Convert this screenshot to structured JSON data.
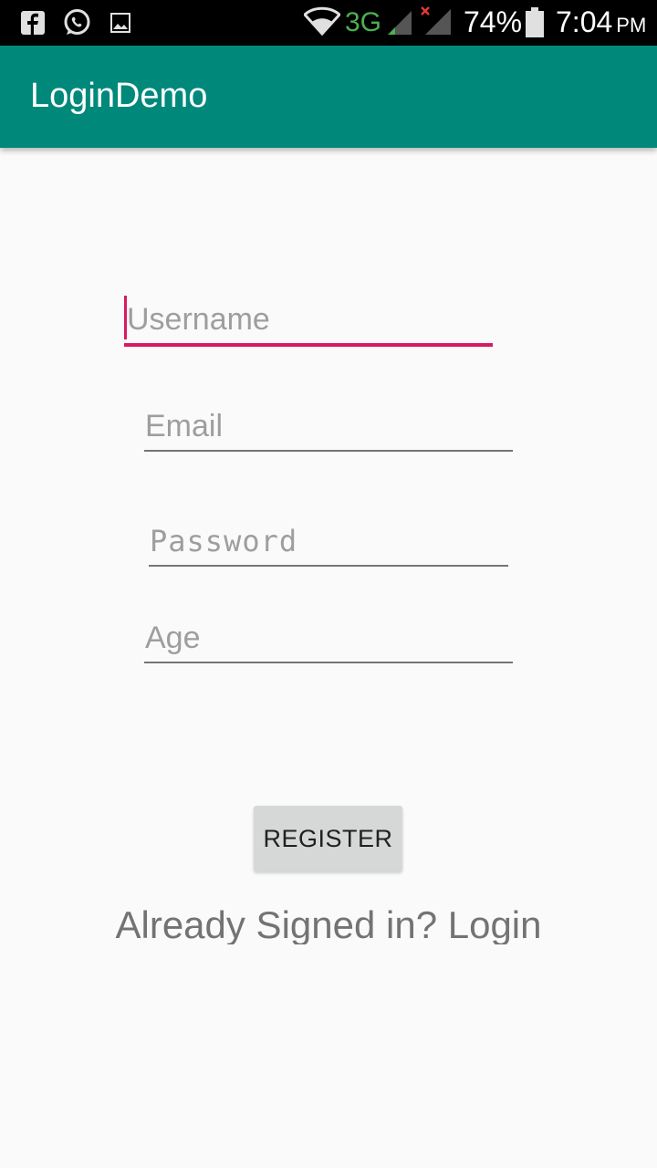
{
  "status_bar": {
    "icons_left": [
      "facebook-icon",
      "whatsapp-icon",
      "gallery-icon"
    ],
    "network": "3G",
    "battery": "74%",
    "time": "7:04",
    "ampm": "PM"
  },
  "app_bar": {
    "title": "LoginDemo",
    "color": "#00897b"
  },
  "form": {
    "username": {
      "placeholder": "Username",
      "value": ""
    },
    "email": {
      "placeholder": "Email",
      "value": ""
    },
    "password": {
      "placeholder": "Password",
      "value": ""
    },
    "age": {
      "placeholder": "Age",
      "value": ""
    }
  },
  "register_label": "REGISTER",
  "login_link": "Already Signed in? Login",
  "colors": {
    "accent": "#d81b60",
    "primary": "#00897b"
  }
}
